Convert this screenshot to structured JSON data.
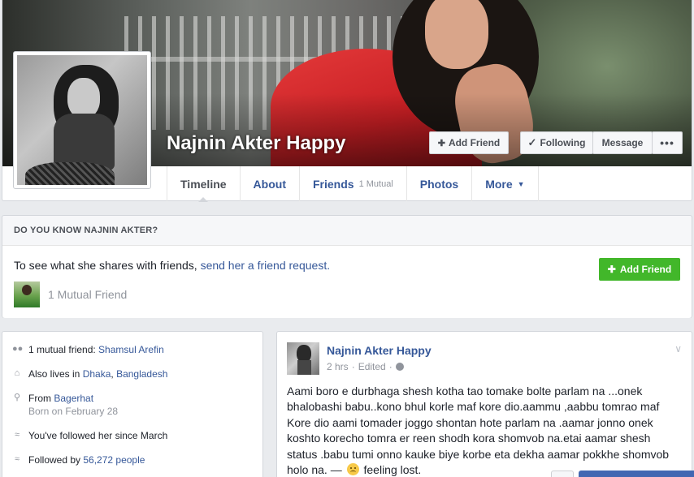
{
  "profile": {
    "name": "Najnin Akter Happy"
  },
  "cover_actions": {
    "add_friend": "Add Friend",
    "following": "Following",
    "message": "Message",
    "more": "•••"
  },
  "tabs": [
    {
      "label": "Timeline",
      "active": true
    },
    {
      "label": "About"
    },
    {
      "label": "Friends",
      "sub": "1 Mutual"
    },
    {
      "label": "Photos"
    },
    {
      "label": "More"
    }
  ],
  "know_card": {
    "title": "DO YOU KNOW NAJNIN AKTER?",
    "text_prefix": "To see what she shares with friends, ",
    "link": "send her a friend request.",
    "button": "Add Friend",
    "mutual": "1 Mutual Friend"
  },
  "intro": {
    "mutual_prefix": "1 mutual friend: ",
    "mutual_name": "Shamsul Arefin",
    "lives_prefix": "Also lives in ",
    "city": "Dhaka",
    "country": "Bangladesh",
    "from_prefix": "From ",
    "from_place": "Bagerhat",
    "born": "Born on February 28",
    "followed_since": "You've followed her since March",
    "followed_prefix": "Followed by ",
    "followers": "56,272 people"
  },
  "post": {
    "author": "Najnin Akter Happy",
    "time": "2 hrs",
    "edited": "Edited",
    "body": "Aami boro e durbhaga shesh kotha tao tomake bolte parlam na ...onek bhalobashi babu..kono bhul korle maf kore dio.aammu ,aabbu tomrao maf Kore dio aami tomader joggo shontan hote parlam na .aamar jonno onek koshto korecho tomra er reen shodh kora shomvob na.etai aamar shesh status .babu tumi onno kauke biye korbe eta dekha aamar pokkhe shomvob holo na.",
    "feeling_prefix": " — ",
    "feeling": "feeling lost."
  },
  "colors": {
    "link": "#365899",
    "green_button": "#42b72a",
    "page_bg": "#e9ebee"
  }
}
